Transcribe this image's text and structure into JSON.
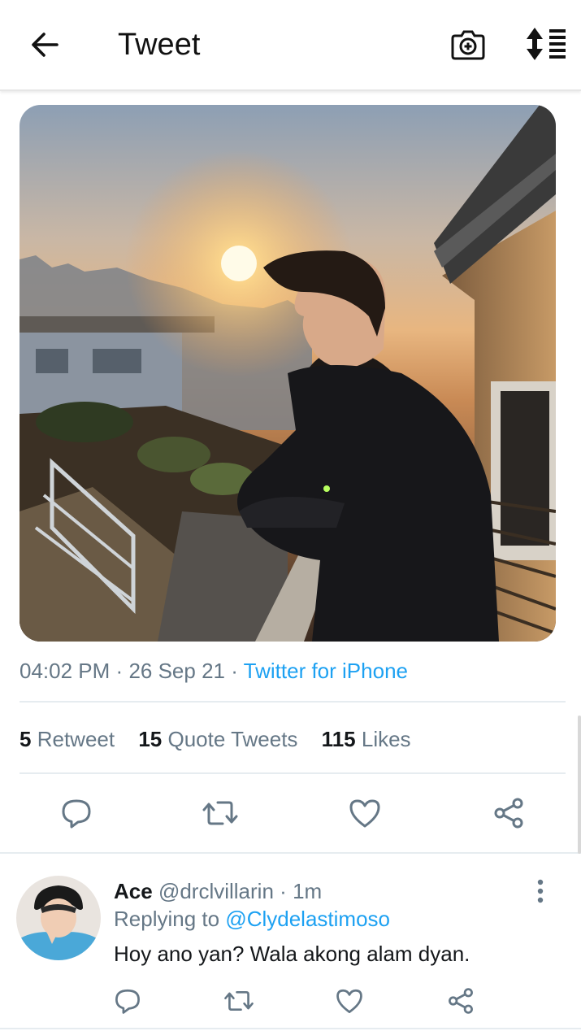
{
  "header": {
    "title": "Tweet",
    "back_icon": "arrow-left-icon",
    "camera_icon": "camera-add-icon",
    "sort_icon": "sort-list-icon"
  },
  "tweet": {
    "media_description_icon": "photo",
    "time": "04:02 PM",
    "date": "26 Sep 21",
    "separator": "·",
    "source": "Twitter for iPhone",
    "stats": {
      "retweets_count": "5",
      "retweets_label": "Retweet",
      "quotes_count": "15",
      "quotes_label": "Quote Tweets",
      "likes_count": "115",
      "likes_label": "Likes"
    },
    "actions": [
      "reply-icon",
      "retweet-icon",
      "like-icon",
      "share-icon"
    ]
  },
  "reply": {
    "name": "Ace",
    "handle": "@drclvillarin",
    "dot": "·",
    "age": "1m",
    "replying_prefix": "Replying to",
    "replying_to": "@Clydelastimoso",
    "text": "Hoy ano yan? Wala akong alam dyan."
  },
  "colors": {
    "accent": "#1da1f2",
    "secondary_text": "#657786",
    "icon": "#657786"
  }
}
